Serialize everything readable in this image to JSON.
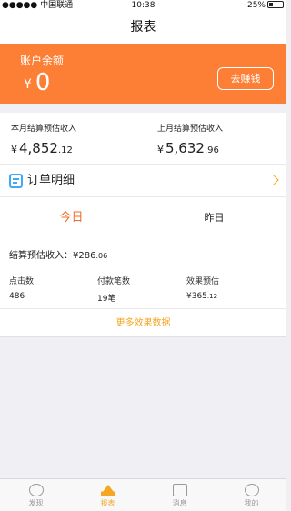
{
  "status_bar": {
    "carrier": "●●●●● 中国联通",
    "time": "10:38",
    "battery": "25%"
  },
  "nav": {
    "title": "报表"
  },
  "balance": {
    "title": "账户余额",
    "currency": "¥",
    "amount": "0",
    "earn_button": "去赚钱"
  },
  "income": {
    "this_month": {
      "label": "本月结算预估收入",
      "currency": "¥",
      "int": "4,852",
      "dec": ".12"
    },
    "last_month": {
      "label": "上月结算预估收入",
      "currency": "¥",
      "int": "5,632",
      "dec": ".96"
    }
  },
  "order_detail": {
    "label": "订单明细"
  },
  "tabs": {
    "today": "今日",
    "yesterday": "昨日"
  },
  "settlement": {
    "label": "结算预估收入：",
    "currency": "¥",
    "int": "286",
    "dec": ".06"
  },
  "stats": [
    {
      "label": "点击数",
      "value": "486",
      "dec": ""
    },
    {
      "label": "付款笔数",
      "value": "19笔",
      "dec": ""
    },
    {
      "label": "效果预估",
      "value": "¥365",
      "dec": ".12"
    }
  ],
  "more_link": "更多效果数据",
  "tab_bar": [
    {
      "label": "发现",
      "icon": "discover-icon"
    },
    {
      "label": "报表",
      "icon": "report-icon"
    },
    {
      "label": "消息",
      "icon": "message-icon"
    },
    {
      "label": "我的",
      "icon": "profile-icon"
    }
  ],
  "colors": {
    "accent": "#fd7e35",
    "highlight": "#f5a623",
    "today_tab": "#f06b26"
  }
}
